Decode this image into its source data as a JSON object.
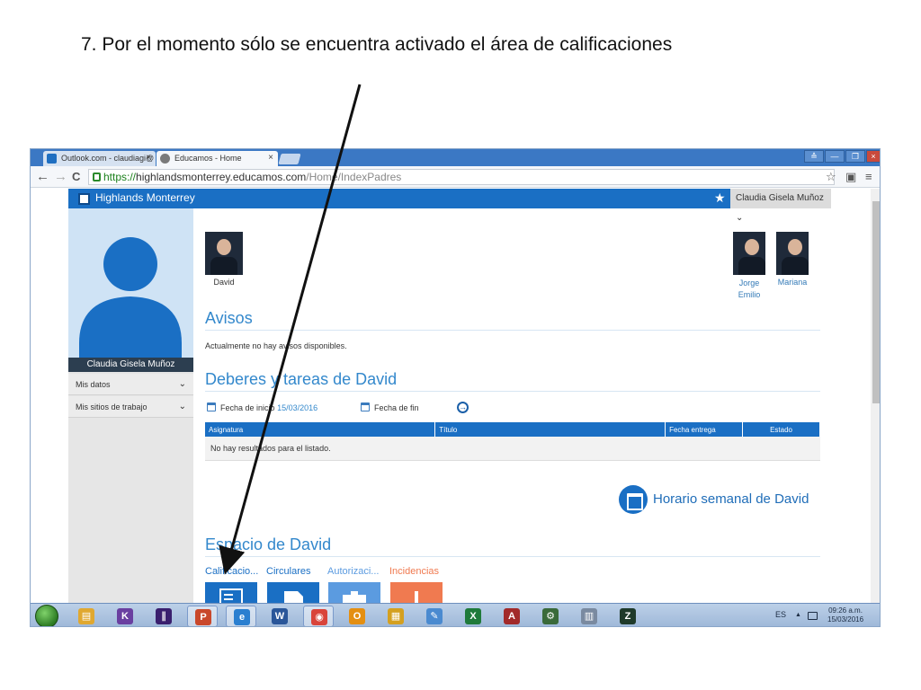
{
  "slide": {
    "title": "7. Por el momento sólo se encuentra activado el área de calificaciones"
  },
  "browser": {
    "tabs": [
      {
        "label": "Outlook.com - claudiagi@",
        "close": "×"
      },
      {
        "label": "Educamos - Home",
        "close": "×"
      }
    ],
    "controls": {
      "restore": "≙",
      "minimize": "—",
      "maximize": "❐",
      "close": "×"
    },
    "address": {
      "scheme": "https://",
      "host": "highlandsmonterrey.educamos.com",
      "path": "/Home/IndexPadres"
    },
    "nav": {
      "back": "←",
      "forward": "→",
      "reload": "C"
    },
    "icons": {
      "bookmark": "☆",
      "extension": "▣",
      "menu": "≡"
    }
  },
  "site": {
    "name": "Highlands Monterrey",
    "user": "Claudia Gisela Muñoz",
    "user_caret": "⌄",
    "star": "★"
  },
  "sidebar": {
    "profile_name": "Claudia Gisela Muñoz",
    "items": [
      {
        "label": "Mis datos",
        "chev": "⌄"
      },
      {
        "label": "Mis sitios de trabajo",
        "chev": "⌄"
      }
    ]
  },
  "children": [
    {
      "name": "David"
    },
    {
      "name": "Jorge Emilio"
    },
    {
      "name": "Mariana"
    }
  ],
  "avisos": {
    "title": "Avisos",
    "message": "Actualmente no hay avisos disponibles."
  },
  "deberes": {
    "title": "Deberes y tareas de David",
    "start_label": "Fecha de inicio",
    "start_value": "15/03/2016",
    "end_label": "Fecha de fin",
    "go": "→",
    "columns": [
      "Asignatura",
      "Título",
      "Fecha entrega",
      "Estado"
    ],
    "empty": "No hay resultados para el listado."
  },
  "horario": {
    "label": "Horario semanal de David"
  },
  "espacio": {
    "title": "Espacio de David",
    "tiles": [
      {
        "label": "Calificacio...",
        "color": "#1a6fc4"
      },
      {
        "label": "Circulares",
        "color": "#1a6fc4"
      },
      {
        "label": "Autorizaci...",
        "color": "#5b9be0"
      },
      {
        "label": "Incidencias",
        "color": "#f07a50"
      }
    ]
  },
  "taskbar": {
    "apps": [
      {
        "name": "file-explorer",
        "glyph": "▤",
        "color": "#e0a830"
      },
      {
        "name": "app-kc",
        "glyph": "K",
        "color": "#6a3fa0"
      },
      {
        "name": "app-onenote-style",
        "glyph": "∥",
        "color": "#3a1f6e"
      },
      {
        "name": "powerpoint",
        "glyph": "P",
        "color": "#c9482b"
      },
      {
        "name": "internet-explorer",
        "glyph": "e",
        "color": "#2a7fd0"
      },
      {
        "name": "word",
        "glyph": "W",
        "color": "#2a5699"
      },
      {
        "name": "chrome",
        "glyph": "◉",
        "color": "#d9443a"
      },
      {
        "name": "outlook",
        "glyph": "O",
        "color": "#e48f12"
      },
      {
        "name": "app-grid",
        "glyph": "▦",
        "color": "#d4a020"
      },
      {
        "name": "paint",
        "glyph": "✎",
        "color": "#4a8ad0"
      },
      {
        "name": "excel",
        "glyph": "X",
        "color": "#1f7a3a"
      },
      {
        "name": "access",
        "glyph": "A",
        "color": "#a22a2a"
      },
      {
        "name": "app-tools",
        "glyph": "⚙",
        "color": "#3a6a3a"
      },
      {
        "name": "calculator",
        "glyph": "▥",
        "color": "#7a8aa0"
      },
      {
        "name": "app-z",
        "glyph": "Z",
        "color": "#1f3a2a"
      }
    ],
    "language": "ES",
    "tray_arrow": "▲",
    "time": "09:26 a.m.",
    "date": "15/03/2016"
  }
}
